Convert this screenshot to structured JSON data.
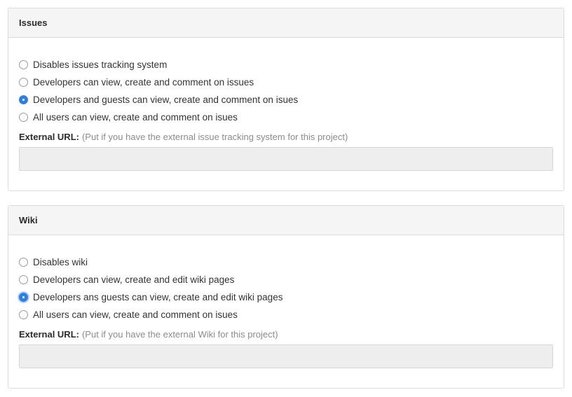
{
  "issues": {
    "title": "Issues",
    "options": [
      {
        "label": "Disables issues tracking system",
        "checked": false
      },
      {
        "label": "Developers can view, create and comment on issues",
        "checked": false
      },
      {
        "label": "Developers and guests can view, create and comment on isues",
        "checked": true
      },
      {
        "label": "All users can view, create and comment on isues",
        "checked": false
      }
    ],
    "url_label": "External URL:",
    "url_hint": "(Put if you have the external issue tracking system for this project)",
    "url_value": ""
  },
  "wiki": {
    "title": "Wiki",
    "options": [
      {
        "label": "Disables wiki",
        "checked": false
      },
      {
        "label": "Developers can view, create and edit wiki pages",
        "checked": false
      },
      {
        "label": "Developers ans guests can view, create and edit wiki pages",
        "checked": true
      },
      {
        "label": "All users can view, create and comment on isues",
        "checked": false
      }
    ],
    "url_label": "External URL:",
    "url_hint": "(Put if you have the external Wiki for this project)",
    "url_value": ""
  },
  "colors": {
    "accent": "#2f7fe0",
    "header_bg": "#f5f5f5",
    "input_bg": "#eeeeee"
  }
}
